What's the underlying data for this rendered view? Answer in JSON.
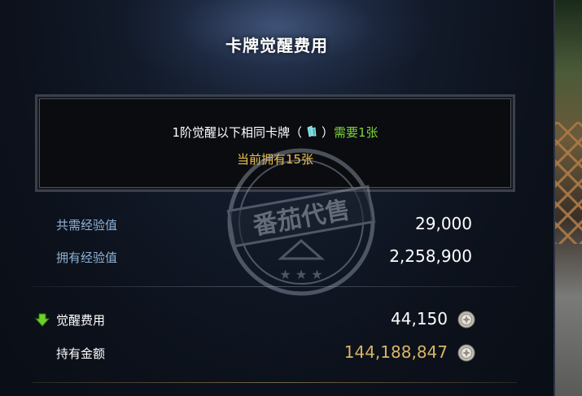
{
  "dialog": {
    "title": "卡牌觉醒费用"
  },
  "requirement": {
    "text_before": "1阶觉醒以下相同卡牌（",
    "text_after": "）",
    "need": "需要1张",
    "owned": "当前拥有15张",
    "card_icon": "card-stack-icon"
  },
  "exp": {
    "total_label": "共需经验值",
    "total_value": "29,000",
    "owned_label": "拥有经验值",
    "owned_value": "2,258,900"
  },
  "cost": {
    "awaken_label": "觉醒费用",
    "awaken_value": "44,150",
    "gold_label": "持有金额",
    "gold_value": "144,188,847",
    "arrow_icon": "green-down-arrow-icon",
    "coin_icon": "silver-coin-icon"
  },
  "watermark": {
    "text": "番茄代售"
  },
  "colors": {
    "highlight_green": "#7ed43a",
    "highlight_gold": "#f2c24c",
    "label_blue": "#8fb2d6",
    "gold_amount": "#d8b466"
  }
}
